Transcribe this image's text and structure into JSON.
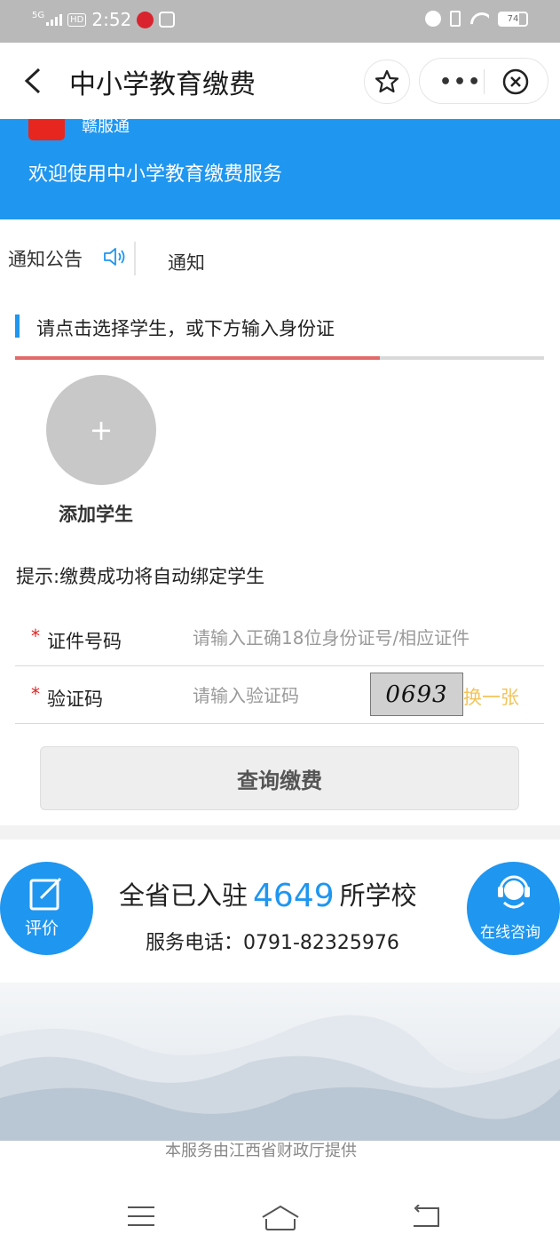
{
  "status_bar": {
    "network": "5G",
    "hd": "HD",
    "time": "2:52",
    "battery": "74"
  },
  "nav": {
    "title": "中小学教育缴费"
  },
  "banner": {
    "logo_text": "赣服通",
    "welcome": "欢迎使用中小学教育缴费服务"
  },
  "notice": {
    "label": "通知公告",
    "text": "通知"
  },
  "section": {
    "title": "请点击选择学生，或下方输入身份证",
    "progress_percent": 69
  },
  "student": {
    "add_symbol": "+",
    "add_label": "添加学生"
  },
  "hint": "提示:缴费成功将自动绑定学生",
  "form": {
    "required_mark": "*",
    "id_label": "证件号码",
    "id_placeholder": "请输入正确18位身份证号/相应证件",
    "captcha_label": "验证码",
    "captcha_placeholder": "请输入验证码",
    "captcha_text": "0693",
    "swap_label": "换一张",
    "query_button": "查询缴费"
  },
  "info": {
    "evaluate_label": "评价",
    "schools_prefix": "全省已入驻",
    "school_count": "4649",
    "schools_suffix": "所学校",
    "phone": "服务电话：0791-82325976",
    "consult_label": "在线咨询"
  },
  "footer": "本服务由江西省财政厅提供",
  "colors": {
    "primary": "#1f96f0",
    "required": "#e02020",
    "swap": "#f2c45a",
    "logo": "#e7261f"
  }
}
